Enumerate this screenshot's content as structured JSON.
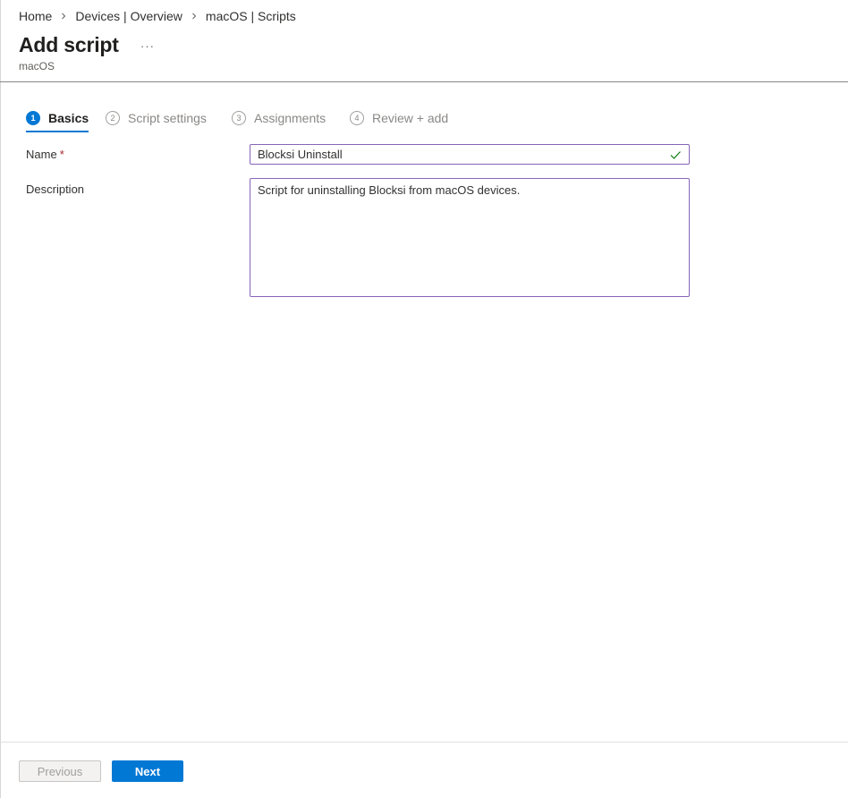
{
  "breadcrumb": {
    "items": [
      "Home",
      "Devices | Overview",
      "macOS | Scripts"
    ]
  },
  "header": {
    "title": "Add script",
    "more_label": "···",
    "subtitle": "macOS"
  },
  "tabs": [
    {
      "number": "1",
      "label": "Basics",
      "state": "active"
    },
    {
      "number": "2",
      "label": "Script settings",
      "state": "inactive"
    },
    {
      "number": "3",
      "label": "Assignments",
      "state": "inactive"
    },
    {
      "number": "4",
      "label": "Review + add",
      "state": "inactive"
    }
  ],
  "form": {
    "name": {
      "label": "Name",
      "required_mark": "*",
      "value": "Blocksi Uninstall",
      "valid_icon": "check-icon"
    },
    "description": {
      "label": "Description",
      "value": "Script for uninstalling Blocksi from macOS devices."
    }
  },
  "footer": {
    "previous_label": "Previous",
    "next_label": "Next"
  },
  "colors": {
    "accent": "#0078d4",
    "field_border": "#8764b8",
    "required": "#a4262c",
    "valid": "#107c10"
  }
}
